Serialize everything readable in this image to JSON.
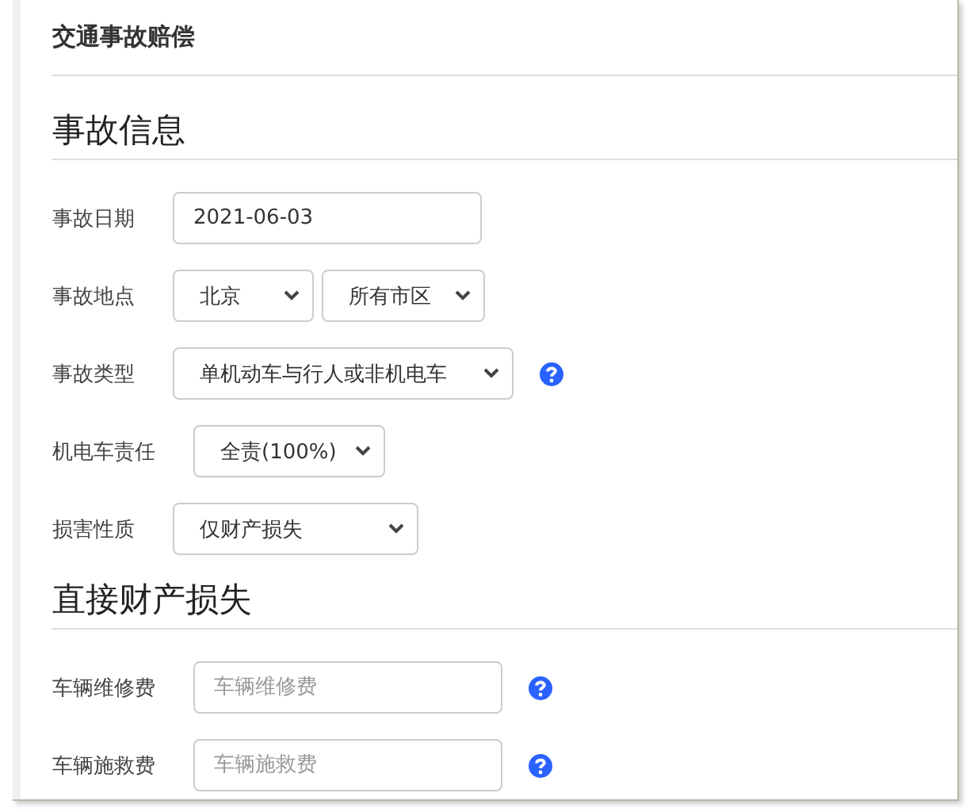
{
  "title": "交通事故赔偿",
  "sections": [
    {
      "heading": "事故信息",
      "rows": [
        {
          "label": "事故日期",
          "help": false,
          "controls": [
            {
              "kind": "input",
              "value": "2021-06-03"
            }
          ]
        },
        {
          "label": "事故地点",
          "help": false,
          "controls": [
            {
              "kind": "select",
              "value": "北京"
            },
            {
              "kind": "select",
              "value": "所有市区"
            }
          ]
        },
        {
          "label": "事故类型",
          "help": true,
          "controls": [
            {
              "kind": "select",
              "value": "单机动车与行人或非机电车"
            }
          ]
        },
        {
          "label": "机电车责任",
          "help": false,
          "controls": [
            {
              "kind": "select",
              "value": "全责(100%)"
            }
          ]
        },
        {
          "label": "损害性质",
          "help": false,
          "controls": [
            {
              "kind": "select",
              "value": "仅财产损失"
            }
          ]
        }
      ]
    },
    {
      "heading": "直接财产损失",
      "rows": [
        {
          "label": "车辆维修费",
          "help": true,
          "controls": [
            {
              "kind": "input",
              "placeholder": "车辆维修费"
            }
          ]
        },
        {
          "label": "车辆施救费",
          "help": true,
          "controls": [
            {
              "kind": "input",
              "placeholder": "车辆施救费"
            }
          ]
        }
      ]
    }
  ]
}
